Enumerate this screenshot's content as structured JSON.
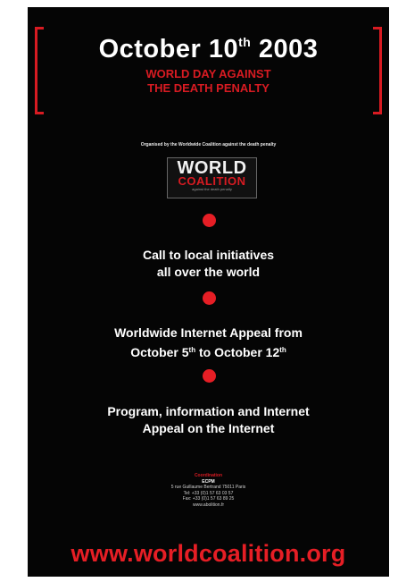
{
  "header": {
    "title_main": "October 10",
    "title_sup": "th",
    "title_year": " 2003",
    "subtitle_line1": "WORLD DAY AGAINST",
    "subtitle_line2": "THE DEATH PENALTY"
  },
  "organizer": {
    "text": "Organised by the Worldwide Coalition against the death penalty"
  },
  "logo": {
    "word1": "WORLD",
    "word2": "COALITION",
    "tagline": "against the death penalty"
  },
  "items": [
    {
      "line1": "Call to local initiatives",
      "line2": "all over the world"
    },
    {
      "line1": "Worldwide Internet Appeal from",
      "line2_a": "October 5",
      "line2_a_sup": "th",
      "line2_b": " to October 12",
      "line2_b_sup": "th"
    },
    {
      "line1": "Program, information and Internet",
      "line2": "Appeal on the Internet"
    }
  ],
  "contact": {
    "heading": "Coordination",
    "name": "ECPM",
    "line1": "5 rue Guillaume Bertrand 75011 Paris",
    "line2": "Tel: +33 (0)1 57 63 03 57",
    "line3": "Fax: +33 (0)1 57 63 89 25",
    "line4": "www.abolition.fr"
  },
  "footer": {
    "url": "www.worldcoalition.org"
  },
  "colors": {
    "background": "#050505",
    "accent_red": "#e61e25",
    "text": "#ffffff"
  }
}
